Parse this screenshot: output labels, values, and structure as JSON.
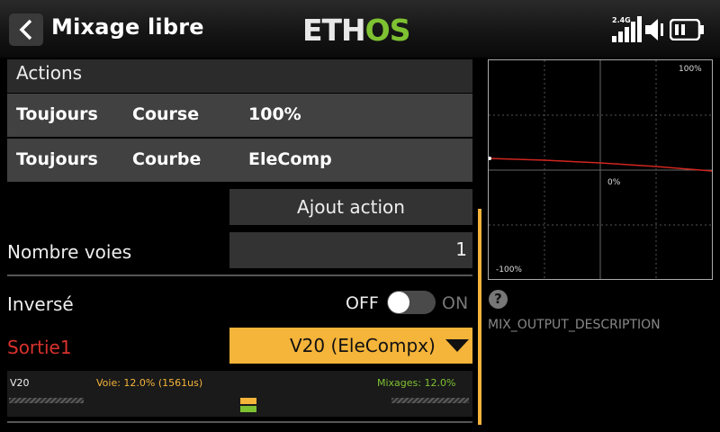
{
  "header": {
    "title": "Mixage libre",
    "logo_left": "ETH",
    "logo_right": "OS",
    "signal_label": "2.4G"
  },
  "actions": {
    "heading": "Actions",
    "rows": [
      {
        "condition": "Toujours",
        "type": "Course",
        "value": "100%"
      },
      {
        "condition": "Toujours",
        "type": "Courbe",
        "value": "EleComp"
      }
    ],
    "add_label": "Ajout action"
  },
  "channels": {
    "label": "Nombre voies",
    "value": "1"
  },
  "invert": {
    "label": "Inversé",
    "off": "OFF",
    "on": "ON",
    "state": false
  },
  "output": {
    "label": "Sortie1",
    "value": "V20 (EleCompx)"
  },
  "monitor": {
    "channel": "V20",
    "voie": "Voie: 12.0% (1561us)",
    "mix": "Mixages: 12.0%"
  },
  "graph": {
    "max_label": "100%",
    "mid_label": "0%",
    "min_label": "-100%"
  },
  "help": {
    "icon_glyph": "?",
    "description": "MIX_OUTPUT_DESCRIPTION"
  },
  "colors": {
    "accent": "#f5b43a",
    "logo_green": "#7ec232",
    "output_red": "#d8322c",
    "curve": "#d0261f"
  }
}
